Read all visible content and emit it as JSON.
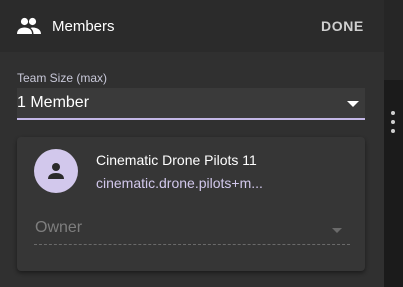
{
  "toolbar": {
    "title": "Members",
    "done_label": "DONE",
    "icon": "people-icon"
  },
  "team_size": {
    "label": "Team Size (max)",
    "selected": "1 Member"
  },
  "member": {
    "name": "Cinematic Drone Pilots 11",
    "email": "cinematic.drone.pilots+m...",
    "avatar_icon": "person-icon",
    "role_placeholder": "Owner"
  },
  "colors": {
    "accent": "#c3b7e6",
    "avatar_bg": "#d2c8ec",
    "background": "#303030"
  }
}
